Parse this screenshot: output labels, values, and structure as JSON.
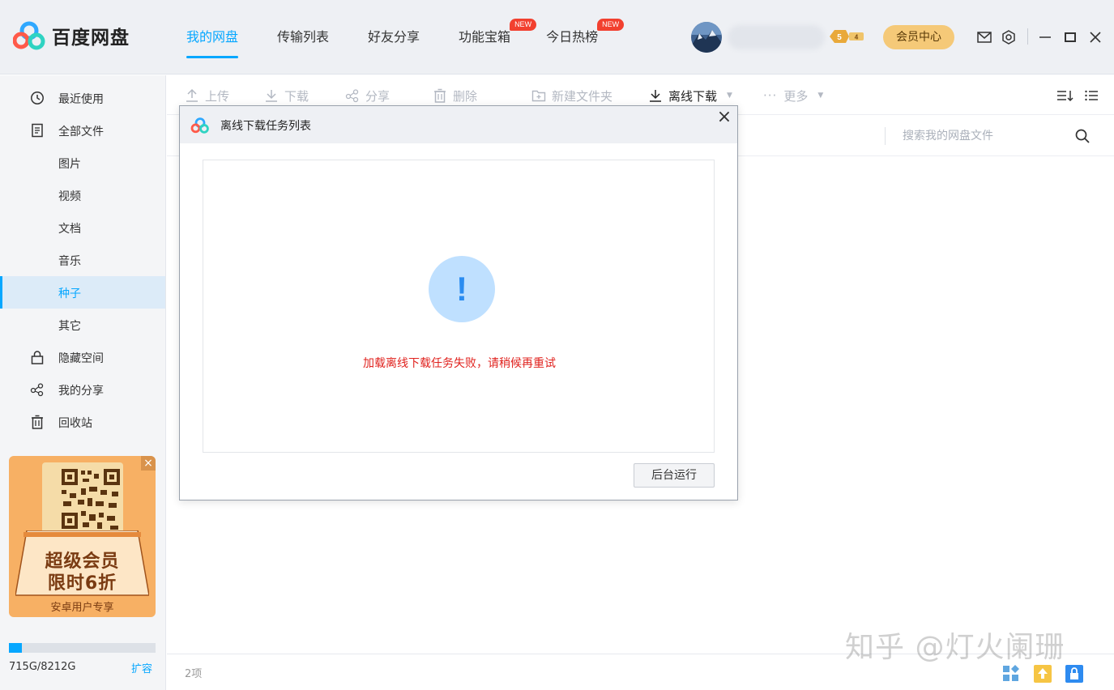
{
  "app": {
    "name": "百度网盘"
  },
  "nav": {
    "tabs": [
      {
        "label": "我的网盘",
        "active": true
      },
      {
        "label": "传输列表"
      },
      {
        "label": "好友分享"
      },
      {
        "label": "功能宝箱",
        "badge": "NEW"
      },
      {
        "label": "今日热榜",
        "badge": "NEW"
      }
    ]
  },
  "header": {
    "level_badge": "5 4",
    "vip_button": "会员中心",
    "icons": [
      "mail-icon",
      "settings-icon",
      "minimize-icon",
      "maximize-icon",
      "close-icon"
    ]
  },
  "sidebar": {
    "items": [
      {
        "label": "最近使用",
        "icon": "clock-icon"
      },
      {
        "label": "全部文件",
        "icon": "file-icon"
      },
      {
        "label": "图片"
      },
      {
        "label": "视频"
      },
      {
        "label": "文档"
      },
      {
        "label": "音乐"
      },
      {
        "label": "种子",
        "active": true
      },
      {
        "label": "其它"
      },
      {
        "label": "隐藏空间",
        "icon": "lock-icon"
      },
      {
        "label": "我的分享",
        "icon": "share-icon"
      },
      {
        "label": "回收站",
        "icon": "trash-icon"
      }
    ],
    "promo": {
      "line1": "超级会员",
      "line2": "限时6折",
      "line3": "安卓用户专享",
      "close": "×"
    },
    "storage": {
      "used_text": "715G/8212G",
      "used_fraction": 0.087,
      "expand_label": "扩容"
    }
  },
  "toolbar": {
    "upload": "上传",
    "download": "下载",
    "share": "分享",
    "delete": "删除",
    "new_folder": "新建文件夹",
    "offline_download": "离线下载",
    "more": "更多"
  },
  "search": {
    "placeholder": "搜索我的网盘文件"
  },
  "status": {
    "item_count": "2项"
  },
  "watermark": "知乎 @灯火阑珊",
  "dialog": {
    "title": "离线下载任务列表",
    "close": "×",
    "alert_mark": "!",
    "message": "加载离线下载任务失败，请稍候再重试",
    "button": "后台运行"
  },
  "colors": {
    "accent": "#06a7ff",
    "error": "#e0221e",
    "vip": "#f5c978",
    "badge_new": "#f2402f"
  }
}
